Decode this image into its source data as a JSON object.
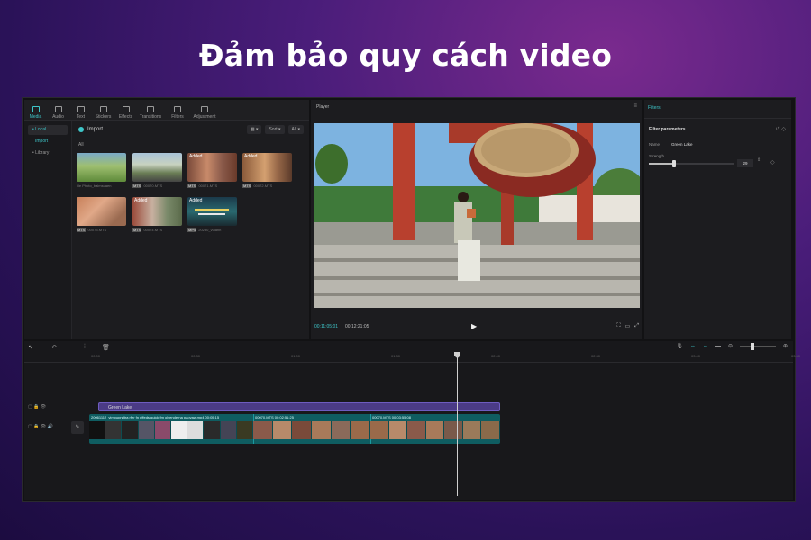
{
  "headline": "Đảm bảo quy cách video",
  "toolbar": {
    "tabs": [
      {
        "label": "Media",
        "icon": "media-icon",
        "active": true
      },
      {
        "label": "Audio",
        "icon": "audio-icon",
        "active": false
      },
      {
        "label": "Text",
        "icon": "text-icon",
        "active": false
      },
      {
        "label": "Stickers",
        "icon": "sticker-icon",
        "active": false
      },
      {
        "label": "Effects",
        "icon": "effects-icon",
        "active": false
      },
      {
        "label": "Transitions",
        "icon": "transitions-icon",
        "active": false
      },
      {
        "label": "Filters",
        "icon": "filters-icon",
        "active": false
      },
      {
        "label": "Adjustment",
        "icon": "adjustment-icon",
        "active": false
      }
    ]
  },
  "leftnav": {
    "local": "• Local",
    "import": "Import",
    "library": "• Library"
  },
  "media": {
    "import_label": "Import",
    "sort_label": "Sort",
    "all_filter": "All",
    "all_label": "All",
    "items": [
      {
        "added": "",
        "duration": "",
        "caption": "file Photo_baimsuaen"
      },
      {
        "added": "",
        "duration": "",
        "caption": "00070.MTS"
      },
      {
        "added": "Added",
        "duration": "",
        "caption": "00071.MTS"
      },
      {
        "added": "Added",
        "duration": "",
        "caption": "00072.MTS"
      },
      {
        "added": "",
        "duration": "",
        "caption": "00073.MTS"
      },
      {
        "added": "Added",
        "duration": "",
        "caption": "00074.MTS"
      },
      {
        "added": "Added",
        "duration": "",
        "caption": "20230_vulanh"
      }
    ]
  },
  "player": {
    "title": "Player",
    "current_time": "00:11:05:01",
    "total_time": "00:12:21:05",
    "play_icon": "play-icon"
  },
  "filters": {
    "tab": "Filters",
    "heading": "Filter parameters",
    "name_label": "Name",
    "name_value": "Green Lake",
    "strength_label": "Strength",
    "strength_value": "29",
    "strength_fraction": 0.29
  },
  "timeline": {
    "ticks": [
      "00:00",
      "00:30",
      "01:00",
      "01:30",
      "02:00",
      "02:30",
      "03:00",
      "03:30"
    ],
    "filter_track_label": "Green Lake",
    "segments": [
      {
        "header": "20061112_vimpupndtra rfer fn effeds quick fm olvenderna paovaw.mp4  00:05:15"
      },
      {
        "header": "00070.MTS  00:02:51:25"
      },
      {
        "header": "00070.MTS  00:03:55:08"
      }
    ]
  }
}
